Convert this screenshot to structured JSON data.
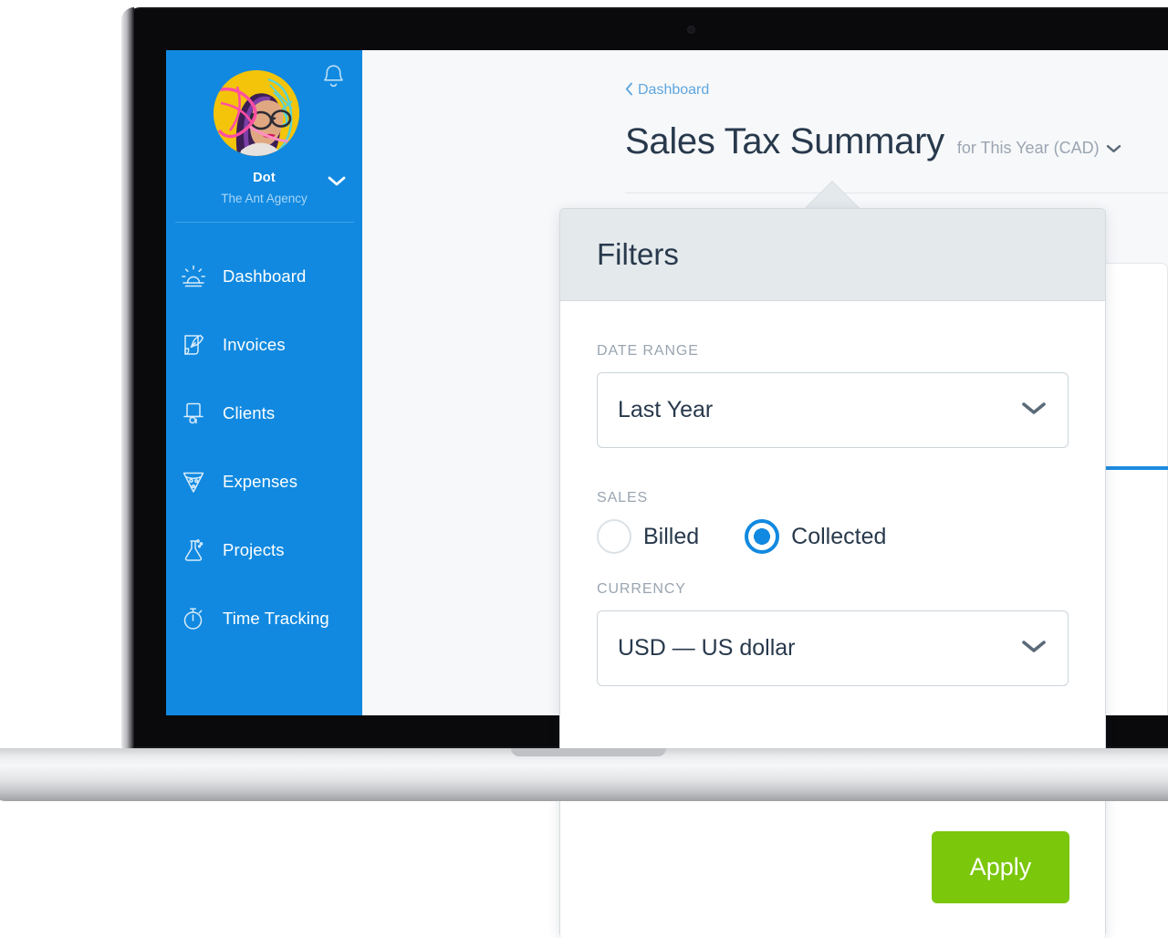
{
  "device": {
    "type": "laptop",
    "webcam": "webcam-dot"
  },
  "sidebar": {
    "bell_icon": "bell-icon",
    "avatar_alt": "user-avatar",
    "profile": {
      "name": "Dot",
      "organization": "The Ant Agency",
      "caret_icon": "chevron-down-icon"
    },
    "items": [
      {
        "label": "Dashboard",
        "icon": "sunrise-icon"
      },
      {
        "label": "Invoices",
        "icon": "invoice-quill-icon"
      },
      {
        "label": "Clients",
        "icon": "briefcase-icon"
      },
      {
        "label": "Expenses",
        "icon": "pizza-slice-icon"
      },
      {
        "label": "Projects",
        "icon": "flask-icon"
      },
      {
        "label": "Time Tracking",
        "icon": "stopwatch-icon"
      }
    ],
    "accent_color": "#1189E0"
  },
  "header": {
    "breadcrumb_chevron": "chevron-left-icon",
    "breadcrumb": "Dashboard",
    "title": "Sales Tax Summary",
    "meta": "for This Year (CAD)",
    "meta_caret": "chevron-down-icon"
  },
  "filters": {
    "title": "Filters",
    "date_range": {
      "label": "DATE RANGE",
      "value": "Last Year",
      "caret_icon": "chevron-down-icon"
    },
    "sales": {
      "label": "SALES",
      "options": [
        {
          "label": "Billed",
          "selected": false
        },
        {
          "label": "Collected",
          "selected": true
        }
      ]
    },
    "currency": {
      "label": "CURRENCY",
      "value": "USD — US dollar",
      "caret_icon": "chevron-down-icon"
    },
    "apply_label": "Apply",
    "apply_color": "#7AC70C"
  }
}
